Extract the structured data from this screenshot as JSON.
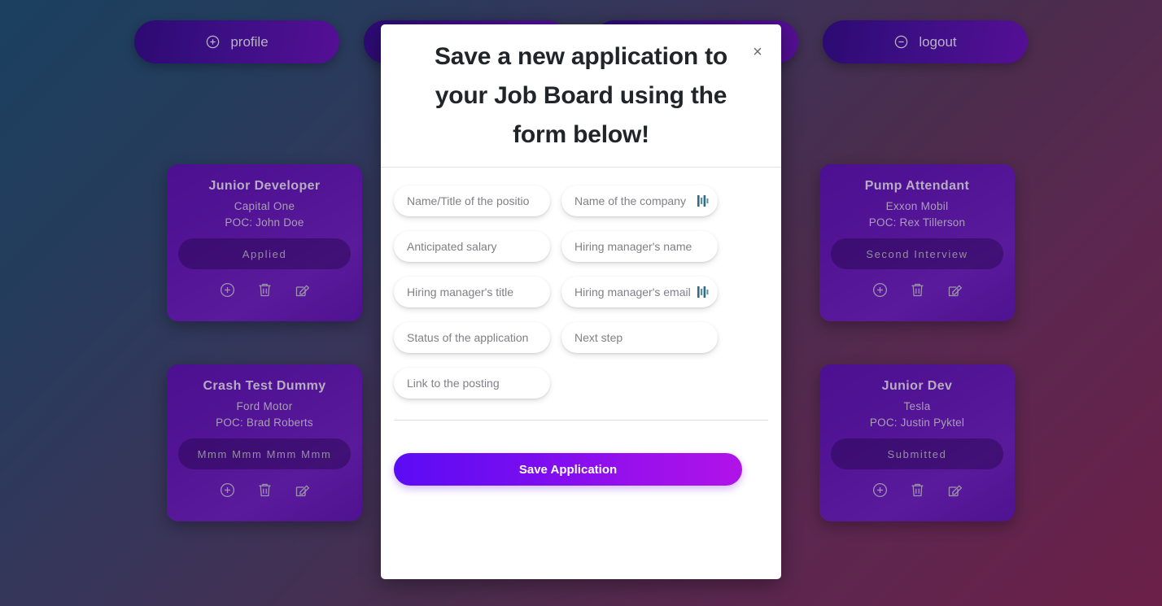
{
  "topnav": {
    "buttons": [
      {
        "label": "profile",
        "icon": "plus-circle-icon"
      },
      {
        "label": "",
        "icon": ""
      },
      {
        "label": "",
        "icon": ""
      },
      {
        "label": "logout",
        "icon": "minus-circle-icon"
      }
    ]
  },
  "board": {
    "cards": [
      {
        "title": "Junior Developer",
        "company": "Capital One",
        "poc": "POC: John Doe",
        "status": "Applied",
        "actions": [
          "add-icon",
          "delete-icon",
          "edit-icon"
        ]
      },
      {
        "title": "Pump Attendant",
        "company": "Exxon Mobil",
        "poc": "POC: Rex Tillerson",
        "status": "Second Interview",
        "actions": [
          "add-icon",
          "delete-icon",
          "edit-icon"
        ]
      },
      {
        "title": "Crash Test Dummy",
        "company": "Ford Motor",
        "poc": "POC: Brad Roberts",
        "status": "Mmm Mmm Mmm Mmm",
        "actions": [
          "add-icon",
          "delete-icon",
          "edit-icon"
        ]
      },
      {
        "title": "Junior Dev",
        "company": "Tesla",
        "poc": "POC: Justin Pyktel",
        "status": "Submitted",
        "actions": [
          "add-icon",
          "delete-icon",
          "edit-icon"
        ]
      }
    ]
  },
  "modal": {
    "title": "Save a new application to your Job Board using the form below!",
    "close_label": "×",
    "fields": [
      {
        "placeholder": "Name/Title of the positio",
        "value": "",
        "autofill": false
      },
      {
        "placeholder": "Name of the company",
        "value": "",
        "autofill": true
      },
      {
        "placeholder": "Anticipated salary",
        "value": "",
        "autofill": false
      },
      {
        "placeholder": "Hiring manager's name",
        "value": "",
        "autofill": false
      },
      {
        "placeholder": "Hiring manager's title",
        "value": "",
        "autofill": false
      },
      {
        "placeholder": "Hiring manager's email",
        "value": "",
        "autofill": true
      },
      {
        "placeholder": "Status of the application",
        "value": "",
        "autofill": false
      },
      {
        "placeholder": "Next step",
        "value": "",
        "autofill": false
      },
      {
        "placeholder": "Link to the posting",
        "value": "",
        "autofill": false
      }
    ],
    "submit_label": "Save Application"
  },
  "colors": {
    "accent_start": "#5b0cf5",
    "accent_end": "#b013e8",
    "card": "#531496",
    "nav_pill": "#3d0f85",
    "bg_top_left": "#1b4060",
    "bg_bottom_right": "#6b2048",
    "autofill_icon": "#2e6e82"
  }
}
